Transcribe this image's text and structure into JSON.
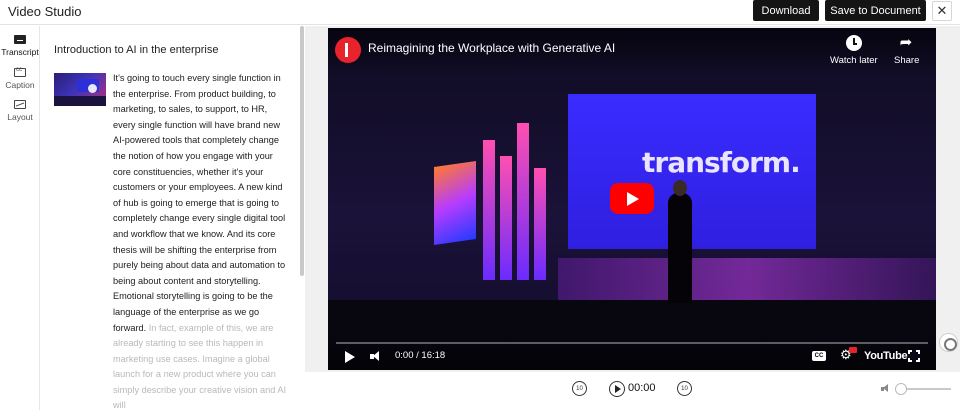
{
  "app": {
    "title": "Video Studio"
  },
  "toolbar": {
    "download_label": "Download",
    "save_label": "Save to Document",
    "close_label": "✕"
  },
  "rail": {
    "items": [
      {
        "label": "Transcript",
        "icon": "transcript-icon",
        "active": true
      },
      {
        "label": "Caption",
        "icon": "caption-icon",
        "active": false
      },
      {
        "label": "Layout",
        "icon": "layout-icon",
        "active": false
      }
    ]
  },
  "transcript": {
    "title": "Introduction to AI in the enterprise",
    "text": "It's going to touch every single function in the enterprise. From product building, to marketing, to sales, to support, to HR, every single function will have brand new AI-powered tools that completely change the notion of how you engage with your core constituencies, whether it's your customers or your employees. A new kind of hub is going to emerge that is going to completely change every single digital tool and workflow that we know. And its core thesis will be shifting the enterprise from purely being about data and automation to being about content and storytelling. Emotional storytelling is going to be the language of the enterprise as we go forward.",
    "text_faded": " In fact, example of this, we are already starting to see this happen in marketing use cases. Imagine a global launch for a new product where you can simply describe your creative vision and AI will"
  },
  "video": {
    "title": "Reimagining the Workplace with Generative AI",
    "watch_later_label": "Watch later",
    "share_label": "Share",
    "stage_text": "transform.",
    "time": "0:00 / 16:18",
    "cc_label": "CC",
    "youtube_label": "YouTube"
  },
  "transport": {
    "time": "00:00",
    "back_label": "10",
    "fwd_label": "10",
    "volume": 0.1
  },
  "colors": {
    "accent": "#141414",
    "youtube_red": "#ff0000",
    "stage_blue": "#3a2cff"
  }
}
